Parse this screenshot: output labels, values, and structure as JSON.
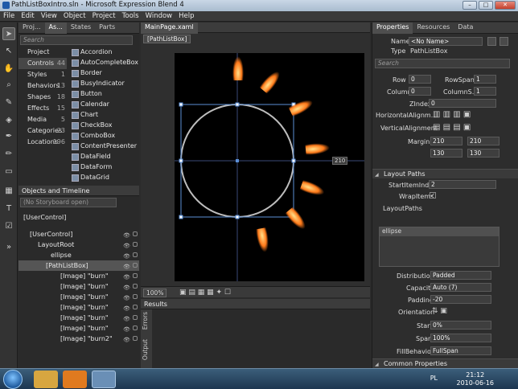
{
  "window": {
    "title": "PathListBoxIntro.sln - Microsoft Expression Blend 4",
    "min": "–",
    "max": "□",
    "close": "✕"
  },
  "menu": [
    "File",
    "Edit",
    "View",
    "Object",
    "Project",
    "Tools",
    "Window",
    "Help"
  ],
  "left_tabs": [
    "Proj...",
    "As...",
    "States",
    "Parts"
  ],
  "assets": {
    "search_placeholder": "Search",
    "categories": [
      {
        "label": "Project",
        "count": ""
      },
      {
        "label": "Controls",
        "count": "44"
      },
      {
        "label": "Styles",
        "count": "1"
      },
      {
        "label": "Behaviors",
        "count": "13"
      },
      {
        "label": "Shapes",
        "count": "18"
      },
      {
        "label": "Effects",
        "count": "15"
      },
      {
        "label": "Media",
        "count": "5"
      },
      {
        "label": "Categories",
        "count": "23"
      },
      {
        "label": "Locations",
        "count": "196"
      }
    ],
    "controls": [
      "Accordion",
      "AutoCompleteBox",
      "Border",
      "BusyIndicator",
      "Button",
      "Calendar",
      "Chart",
      "CheckBox",
      "ComboBox",
      "ContentPresenter",
      "DataField",
      "DataForm",
      "DataGrid"
    ]
  },
  "objects": {
    "title": "Objects and Timeline",
    "storyboard": "(No Storyboard open)",
    "root": "[UserControl]",
    "tree": [
      {
        "label": "[UserControl]",
        "indent": 0
      },
      {
        "label": "LayoutRoot",
        "indent": 1
      },
      {
        "label": "ellipse",
        "indent": 2
      },
      {
        "label": "[PathListBox]",
        "indent": 2,
        "selected": true
      },
      {
        "label": "[Image] \"burn\"",
        "indent": 3
      },
      {
        "label": "[Image] \"burn\"",
        "indent": 3
      },
      {
        "label": "[Image] \"burn\"",
        "indent": 3
      },
      {
        "label": "[Image] \"burn\"",
        "indent": 3
      },
      {
        "label": "[Image] \"burn\"",
        "indent": 3
      },
      {
        "label": "[Image] \"burn\"",
        "indent": 3
      },
      {
        "label": "[Image] \"burn2\"",
        "indent": 3
      }
    ]
  },
  "document": {
    "tab": "MainPage.xaml",
    "breadcrumb": "[PathListBox]",
    "zoom": "100%",
    "size_label": "210",
    "results_title": "Results",
    "results_tabs": [
      "Errors",
      "Output"
    ]
  },
  "props": {
    "tabs": [
      "Properties",
      "Resources",
      "Data"
    ],
    "name_label": "Name",
    "name_value": "<No Name>",
    "type_label": "Type",
    "type_value": "PathListBox",
    "search_placeholder": "Search",
    "row_label": "Row",
    "row_value": "0",
    "rowspan_label": "RowSpan",
    "rowspan_value": "1",
    "column_label": "Column",
    "column_value": "0",
    "colspan_label": "ColumnS...",
    "colspan_value": "1",
    "zindex_label": "ZIndex",
    "zindex_value": "0",
    "halign_label": "HorizontalAlignm...",
    "valign_label": "VerticalAlignment",
    "margin_label": "Margin",
    "margins": [
      "210",
      "210",
      "130",
      "130"
    ],
    "layout_paths_title": "Layout Paths",
    "startitem_label": "StartItemIndex",
    "startitem_value": "2",
    "wrap_label": "WrapItems",
    "wrap_value": "✓",
    "layoutpaths_label": "LayoutPaths",
    "path_item": "ellipse",
    "distribution_label": "Distribution",
    "distribution_value": "Padded",
    "capacity_label": "Capacity",
    "capacity_value": "Auto (7)",
    "padding_label": "Padding",
    "padding_value": "-20",
    "orientation_label": "Orientation",
    "start_label": "Start",
    "start_value": "0%",
    "span_label": "Span",
    "span_value": "100%",
    "fill_label": "FillBehavior",
    "fill_value": "FullSpan",
    "common_title": "Common Properties"
  },
  "taskbar": {
    "lang": "PL",
    "time": "21:12",
    "date": "2010-06-16"
  },
  "colors": {
    "accent": "#5b8fd6",
    "flame": "#ff7a1a",
    "selection": "#555555"
  }
}
